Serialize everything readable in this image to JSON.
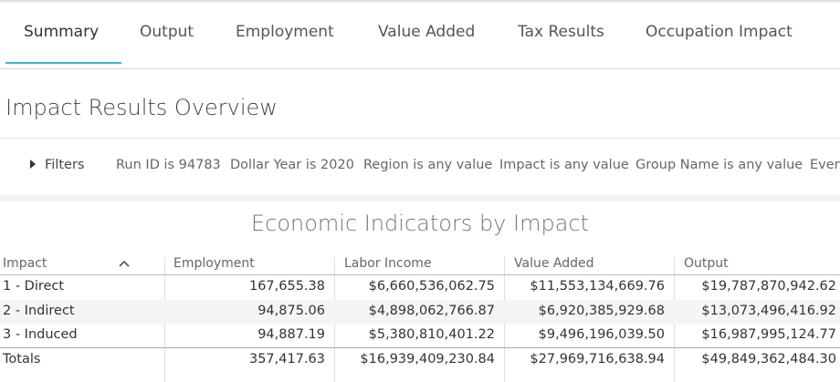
{
  "tabs": [
    {
      "label": "Summary",
      "active": true
    },
    {
      "label": "Output"
    },
    {
      "label": "Employment"
    },
    {
      "label": "Value Added"
    },
    {
      "label": "Tax Results"
    },
    {
      "label": "Occupation Impact"
    }
  ],
  "colors": {
    "accent": "#3fb6c6"
  },
  "page_title": "Impact Results Overview",
  "filters": {
    "toggle_label": "Filters",
    "toggle_icon": "caret-right-icon",
    "chips": [
      "Run ID is 94783",
      "Dollar Year is 2020",
      "Region is any value",
      "Impact is any value",
      "Group Name is any value",
      "Even"
    ]
  },
  "chart_data": {
    "type": "table",
    "title": "Economic Indicators by Impact",
    "sort_icon": "chevron-up-icon",
    "columns": [
      "Impact",
      "Employment",
      "Labor Income",
      "Value Added",
      "Output"
    ],
    "rows": [
      [
        "1 - Direct",
        "167,655.38",
        "$6,660,536,062.75",
        "$11,553,134,669.76",
        "$19,787,870,942.62"
      ],
      [
        "2 - Indirect",
        "94,875.06",
        "$4,898,062,766.87",
        "$6,920,385,929.68",
        "$13,073,496,416.92"
      ],
      [
        "3 - Induced",
        "94,887.19",
        "$5,380,810,401.22",
        "$9,496,196,039.50",
        "$16,987,995,124.77"
      ]
    ],
    "totals": [
      "Totals",
      "357,417.63",
      "$16,939,409,230.84",
      "$27,969,716,638.94",
      "$49,849,362,484.30"
    ]
  }
}
